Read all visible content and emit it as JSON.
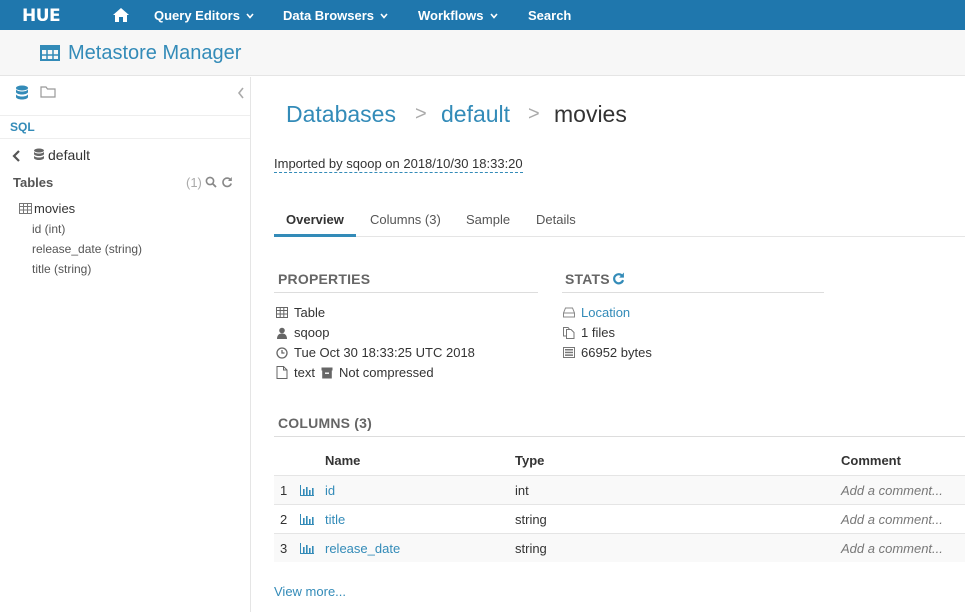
{
  "nav": {
    "logo": "HUE",
    "items": [
      "Query Editors",
      "Data Browsers",
      "Workflows",
      "Search"
    ]
  },
  "app": {
    "title": "Metastore Manager"
  },
  "sidebar": {
    "section": "SQL",
    "database": "default",
    "tables_label": "Tables",
    "tables_count": "(1)",
    "table": "movies",
    "columns": [
      "id (int)",
      "release_date (string)",
      "title (string)"
    ]
  },
  "breadcrumb": {
    "databases": "Databases",
    "sep": ">",
    "database": "default",
    "table": "movies"
  },
  "imported": "Imported by sqoop on 2018/10/30 18:33:20",
  "tabs": [
    "Overview",
    "Columns (3)",
    "Sample",
    "Details"
  ],
  "properties": {
    "title": "PROPERTIES",
    "type": "Table",
    "owner": "sqoop",
    "created": "Tue Oct 30 18:33:25 UTC 2018",
    "format": "text",
    "compression": "Not compressed"
  },
  "stats": {
    "title": "STATS",
    "location": "Location",
    "files": "1 files",
    "size": "66952 bytes"
  },
  "columns_section": {
    "title": "COLUMNS (3)",
    "headers": [
      "Name",
      "Type",
      "Comment"
    ],
    "rows": [
      {
        "num": "1",
        "name": "id",
        "type": "int",
        "comment": "Add a comment..."
      },
      {
        "num": "2",
        "name": "title",
        "type": "string",
        "comment": "Add a comment..."
      },
      {
        "num": "3",
        "name": "release_date",
        "type": "string",
        "comment": "Add a comment..."
      }
    ],
    "view_more": "View more..."
  },
  "colors": {
    "nav_bg": "#1f77ad",
    "accent": "#338bb8"
  }
}
